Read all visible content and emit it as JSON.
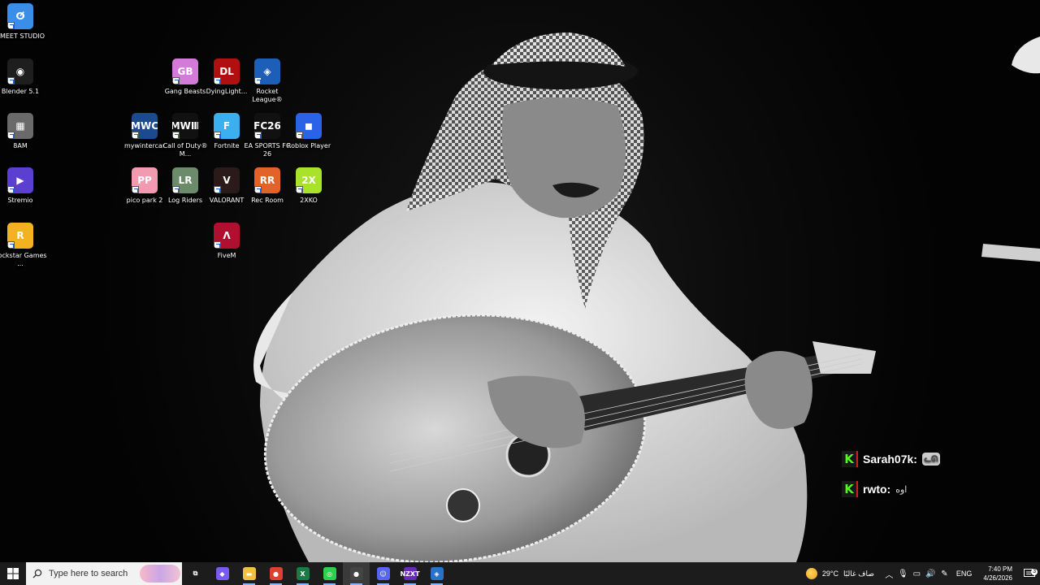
{
  "desktop": {
    "icons": [
      {
        "label": "EMEET STUDIO",
        "glyph": "ⵚ",
        "color": "#3a8ee8"
      },
      {
        "label": "Blender 5.1",
        "glyph": "◉",
        "color": "#1e1e1e"
      },
      {
        "label": "8AM",
        "glyph": "▦",
        "color": "#6a6a6a"
      },
      {
        "label": "Stremio",
        "glyph": "▶",
        "color": "#5a3fd0"
      },
      {
        "label": "Rockstar Games ...",
        "glyph": "R",
        "color": "#f3b21f"
      },
      {
        "label": "Gang Beasts",
        "glyph": "GB",
        "color": "#d47bd9"
      },
      {
        "label": "DyingLight...",
        "glyph": "DL",
        "color": "#b01010"
      },
      {
        "label": "Rocket League®",
        "glyph": "◈",
        "color": "#1d5fb8"
      },
      {
        "label": "mywintercar",
        "glyph": "MWC",
        "color": "#1b4a8e"
      },
      {
        "label": "Call of Duty® M...",
        "glyph": "MWⅢ",
        "color": "#111111"
      },
      {
        "label": "Fortnite",
        "glyph": "F",
        "color": "#3ab0f0"
      },
      {
        "label": "EA SPORTS FC 26",
        "glyph": "FC26",
        "color": "#111111"
      },
      {
        "label": "Roblox Player",
        "glyph": "◼",
        "color": "#2a63e8"
      },
      {
        "label": "pico park 2",
        "glyph": "PP",
        "color": "#f29ab0"
      },
      {
        "label": "Log Riders",
        "glyph": "LR",
        "color": "#6b8b6a"
      },
      {
        "label": "VALORANT",
        "glyph": "V",
        "color": "#2a1a1a"
      },
      {
        "label": "Rec Room",
        "glyph": "RR",
        "color": "#e2632a"
      },
      {
        "label": "2XKO",
        "glyph": "2X",
        "color": "#a8e22a"
      },
      {
        "label": "FiveM",
        "glyph": "Λ",
        "color": "#b01030"
      }
    ]
  },
  "chat": {
    "messages": [
      {
        "user": "Sarah07k:",
        "text": "🐱"
      },
      {
        "user": "rwto:",
        "text": "اوه"
      }
    ],
    "badge": "K",
    "badge_color": "#53fc18"
  },
  "taskbar": {
    "search_placeholder": "Type here to search",
    "apps": [
      {
        "name": "task-view",
        "glyph": "⧉",
        "color": "transparent"
      },
      {
        "name": "copilot",
        "glyph": "◆",
        "color": "#7a5af0"
      },
      {
        "name": "file-explorer",
        "glyph": "▬",
        "color": "#f0c040"
      },
      {
        "name": "chrome",
        "glyph": "●",
        "color": "#e04030"
      },
      {
        "name": "excel",
        "glyph": "X",
        "color": "#1e7a45"
      },
      {
        "name": "razer",
        "glyph": "◎",
        "color": "#2bd24a"
      },
      {
        "name": "recording-app",
        "glyph": "●",
        "color": "#444444"
      },
      {
        "name": "discord",
        "glyph": "☺",
        "color": "#5865f2"
      },
      {
        "name": "nzxt-cam",
        "glyph": "NZXT",
        "color": "#6a2ab8"
      },
      {
        "name": "shield-app",
        "glyph": "◈",
        "color": "#2a72c8"
      }
    ],
    "weather": {
      "temp": "29°C",
      "condition": "صاف غالبًا"
    },
    "language": "ENG",
    "time": "7:40 PM",
    "date": "4/26/2026",
    "notification_count": "3"
  }
}
